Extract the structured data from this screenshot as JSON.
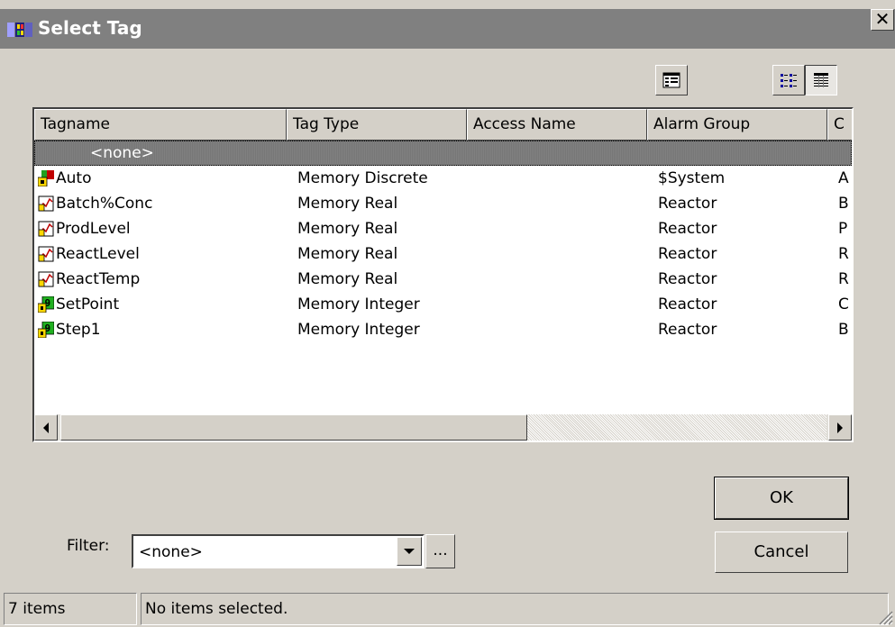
{
  "window": {
    "title": "Select Tag",
    "close_label": "✕"
  },
  "toolbar": {
    "icons": [
      "properties-icon",
      "list-view-icon",
      "details-view-icon"
    ]
  },
  "list": {
    "columns": [
      "Tagname",
      "Tag Type",
      "Access Name",
      "Alarm Group",
      "C"
    ],
    "none_row": "<none>",
    "rows": [
      {
        "icon": "discrete-tag-icon",
        "tagname": "Auto",
        "tag_type": "Memory Discrete",
        "access_name": "",
        "alarm_group": "$System",
        "c": "A"
      },
      {
        "icon": "real-tag-icon",
        "tagname": "Batch%Conc",
        "tag_type": "Memory Real",
        "access_name": "",
        "alarm_group": "Reactor",
        "c": "B"
      },
      {
        "icon": "real-tag-icon",
        "tagname": "ProdLevel",
        "tag_type": "Memory Real",
        "access_name": "",
        "alarm_group": "Reactor",
        "c": "P"
      },
      {
        "icon": "real-tag-icon",
        "tagname": "ReactLevel",
        "tag_type": "Memory Real",
        "access_name": "",
        "alarm_group": "Reactor",
        "c": "R"
      },
      {
        "icon": "real-tag-icon",
        "tagname": "ReactTemp",
        "tag_type": "Memory Real",
        "access_name": "",
        "alarm_group": "Reactor",
        "c": "R"
      },
      {
        "icon": "integer-tag-icon",
        "tagname": "SetPoint",
        "tag_type": "Memory Integer",
        "access_name": "",
        "alarm_group": "Reactor",
        "c": "C"
      },
      {
        "icon": "integer-tag-icon",
        "tagname": "Step1",
        "tag_type": "Memory Integer",
        "access_name": "",
        "alarm_group": "Reactor",
        "c": "B"
      }
    ]
  },
  "buttons": {
    "ok": "OK",
    "cancel": "Cancel",
    "ellipsis": "..."
  },
  "filter": {
    "label": "Filter:",
    "value": "<none>"
  },
  "status": {
    "count": "7 items",
    "message": "No items selected."
  }
}
